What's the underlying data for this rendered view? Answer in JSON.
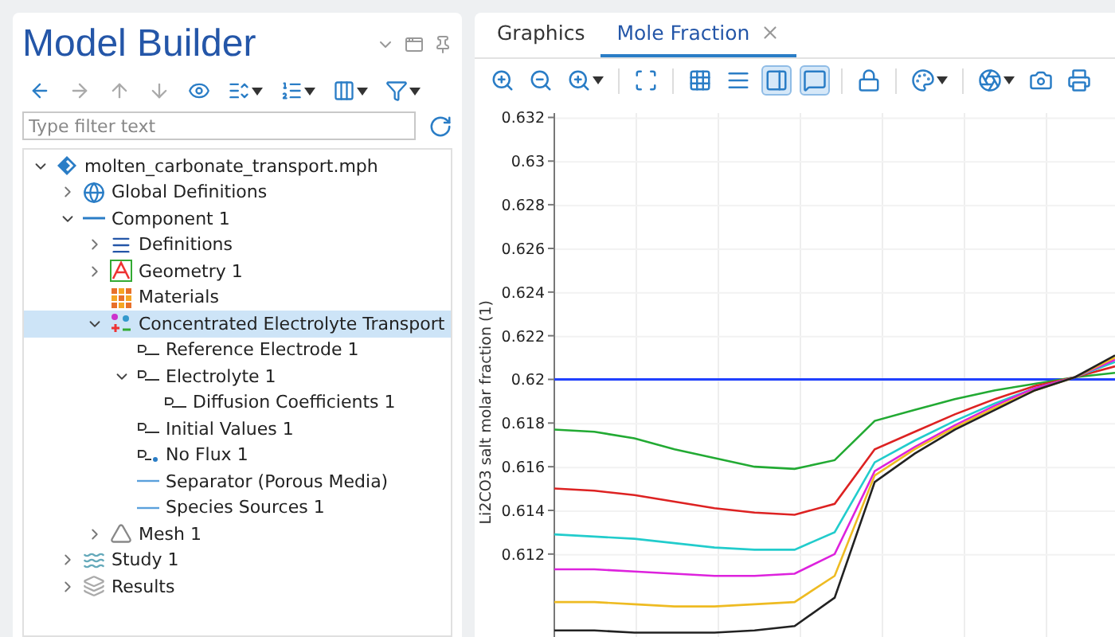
{
  "model_builder": {
    "title": "Model Builder",
    "toolbar": [
      {
        "kind": "back",
        "disabled": false
      },
      {
        "kind": "forward",
        "disabled": true
      },
      {
        "kind": "up",
        "disabled": true
      },
      {
        "kind": "down",
        "disabled": true
      },
      {
        "kind": "show",
        "disabled": false
      },
      {
        "kind": "expand-menu",
        "disabled": false
      },
      {
        "kind": "collapse-menu",
        "disabled": false
      },
      {
        "kind": "columns-menu",
        "disabled": false
      },
      {
        "kind": "filter-menu",
        "disabled": false
      }
    ],
    "filter": {
      "placeholder": "Type filter text"
    },
    "tree": [
      {
        "label": "molten_carbonate_transport.mph",
        "kind": "file",
        "expanded": true,
        "selected": false,
        "children": [
          {
            "label": "Global Definitions",
            "kind": "globe",
            "expanded": false,
            "selected": false
          },
          {
            "label": "Component 1",
            "kind": "component",
            "expanded": true,
            "selected": false,
            "children": [
              {
                "label": "Definitions",
                "kind": "definitions",
                "expanded": false,
                "selected": false
              },
              {
                "label": "Geometry 1",
                "kind": "geometry",
                "expanded": false,
                "selected": false
              },
              {
                "label": "Materials",
                "kind": "materials",
                "selected": false
              },
              {
                "label": "Concentrated Electrolyte Transport",
                "kind": "physics",
                "expanded": true,
                "selected": true,
                "children": [
                  {
                    "label": "Reference Electrode 1",
                    "kind": "default-node",
                    "selected": false
                  },
                  {
                    "label": "Electrolyte 1",
                    "kind": "default-node",
                    "expanded": true,
                    "selected": false,
                    "children": [
                      {
                        "label": "Diffusion Coefficients 1",
                        "kind": "default-node",
                        "selected": false
                      }
                    ]
                  },
                  {
                    "label": "Initial Values 1",
                    "kind": "default-node",
                    "selected": false
                  },
                  {
                    "label": "No Flux 1",
                    "kind": "default-point",
                    "selected": false
                  },
                  {
                    "label": "Separator (Porous Media)",
                    "kind": "node",
                    "selected": false
                  },
                  {
                    "label": "Species Sources 1",
                    "kind": "node",
                    "selected": false
                  }
                ]
              },
              {
                "label": "Mesh 1",
                "kind": "mesh",
                "expanded": false,
                "selected": false
              }
            ]
          },
          {
            "label": "Study 1",
            "kind": "study",
            "expanded": false,
            "selected": false
          },
          {
            "label": "Results",
            "kind": "results",
            "expanded": false,
            "selected": false
          }
        ]
      }
    ]
  },
  "tabs": [
    {
      "label": "Graphics",
      "selected": false,
      "closable": false
    },
    {
      "label": "Mole Fraction",
      "selected": true,
      "closable": true
    }
  ],
  "plot_toolbar": [
    {
      "kind": "zoom-in",
      "on": false
    },
    {
      "kind": "zoom-out",
      "on": false
    },
    {
      "kind": "zoom-box-menu",
      "on": false
    },
    {
      "kind": "zoom-extents",
      "on": false
    },
    {
      "kind": "x-grid",
      "on": false
    },
    {
      "kind": "y-grid",
      "on": false
    },
    {
      "kind": "legend",
      "on": true
    },
    {
      "kind": "tooltip",
      "on": true
    },
    {
      "kind": "lock",
      "on": false
    },
    {
      "kind": "color-menu",
      "on": false
    },
    {
      "kind": "scene-menu",
      "on": false
    },
    {
      "kind": "image",
      "on": false
    },
    {
      "kind": "print",
      "on": false
    }
  ],
  "chart_data": {
    "type": "line",
    "ylabel": "Li2CO3 salt molar fraction (1)",
    "grid": true,
    "ylim": [
      0.6082,
      0.6322
    ],
    "yticks": [
      0.612,
      0.614,
      0.616,
      0.618,
      {
        "value": 0.62,
        "label": "0.62"
      },
      0.622,
      0.624,
      0.626,
      0.628,
      {
        "value": 0.63,
        "label": "0.63"
      },
      0.632
    ],
    "series": [
      {
        "color": "#2040ff",
        "values": [
          0.62,
          0.62,
          0.62,
          0.62,
          0.62,
          0.62,
          0.62,
          0.62,
          0.62,
          0.62,
          0.62,
          0.62,
          0.62,
          0.62,
          0.62
        ]
      },
      {
        "color": "#22aa33",
        "values": [
          0.6177,
          0.6176,
          0.6173,
          0.6168,
          0.6164,
          0.616,
          0.6159,
          0.6163,
          0.6181,
          0.6186,
          0.6191,
          0.6195,
          0.6198,
          0.6201,
          0.6203
        ]
      },
      {
        "color": "#dd2222",
        "values": [
          0.615,
          0.6149,
          0.6147,
          0.6144,
          0.6141,
          0.6139,
          0.6138,
          0.6143,
          0.6168,
          0.6176,
          0.6184,
          0.6191,
          0.6197,
          0.6201,
          0.6206
        ]
      },
      {
        "color": "#22cccc",
        "values": [
          0.6129,
          0.6128,
          0.6127,
          0.6125,
          0.6123,
          0.6122,
          0.6122,
          0.613,
          0.6162,
          0.6172,
          0.6181,
          0.6189,
          0.6196,
          0.6201,
          0.6208
        ]
      },
      {
        "color": "#dd22dd",
        "values": [
          0.6113,
          0.6113,
          0.6112,
          0.6111,
          0.611,
          0.611,
          0.6111,
          0.612,
          0.6158,
          0.6169,
          0.6179,
          0.6188,
          0.6196,
          0.6201,
          0.6209
        ]
      },
      {
        "color": "#eebb22",
        "values": [
          0.6098,
          0.6098,
          0.6097,
          0.6096,
          0.6096,
          0.6097,
          0.6098,
          0.611,
          0.6156,
          0.6168,
          0.6178,
          0.6187,
          0.6195,
          0.6201,
          0.621
        ]
      },
      {
        "color": "#222222",
        "values": [
          0.6085,
          0.6085,
          0.6084,
          0.6084,
          0.6084,
          0.6085,
          0.6087,
          0.61,
          0.6153,
          0.6166,
          0.6177,
          0.6186,
          0.6195,
          0.6201,
          0.6211
        ]
      }
    ]
  }
}
